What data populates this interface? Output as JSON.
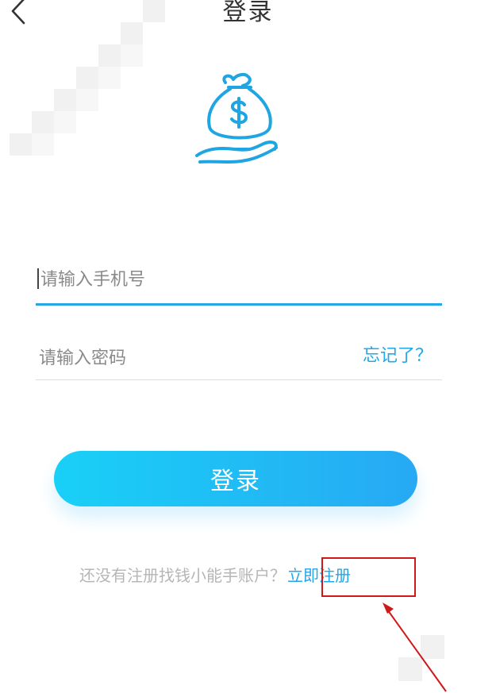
{
  "header": {
    "title": "登录",
    "back_icon": "chevron-left-icon"
  },
  "logo": {
    "icon": "money-bag-hand-icon",
    "color": "#1fa6e2"
  },
  "form": {
    "phone_placeholder": "请输入手机号",
    "password_placeholder": "请输入密码",
    "forgot_label": "忘记了？"
  },
  "actions": {
    "login_label": "登录"
  },
  "register": {
    "prompt": "还没有注册找钱小能手账户？",
    "link_label": "立即注册"
  },
  "colors": {
    "accent": "#22a7e8",
    "button_gradient_start": "#19d0f7",
    "button_gradient_end": "#27a9f3",
    "annotation": "#d01818"
  }
}
